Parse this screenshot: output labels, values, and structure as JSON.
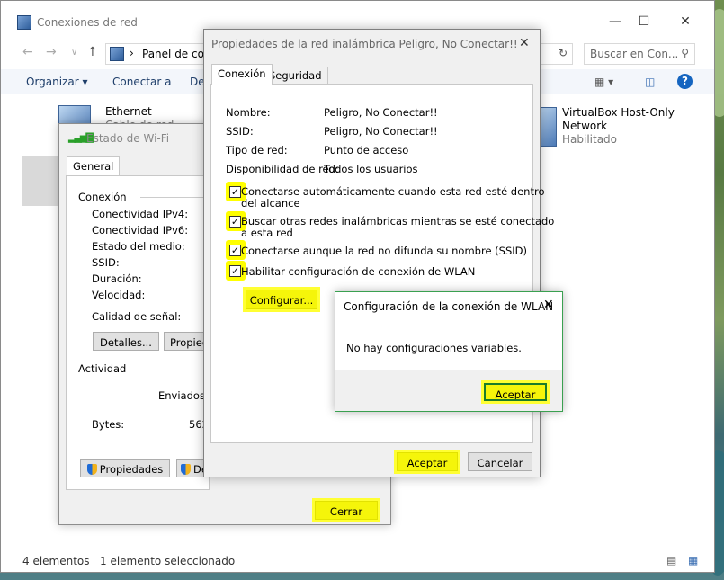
{
  "explorer": {
    "title": "Conexiones de red",
    "address_label": "Panel de cont",
    "search_placeholder": "Buscar en Con...",
    "cmd": {
      "organizar": "Organizar",
      "conectar": "Conectar a",
      "des": "Des"
    },
    "items": [
      {
        "name": "Ethernet",
        "sub": "Cable de red..."
      },
      {
        "name": "VirtualBox Host-Only",
        "name2": "Network",
        "sub": "Habilitado"
      }
    ],
    "status": {
      "count": "4 elementos",
      "selected": "1 elemento seleccionado"
    }
  },
  "wifi_status": {
    "title": "Estado de Wi-Fi",
    "tab": "General",
    "section_connection": "Conexión",
    "fields": [
      "Conectividad IPv4:",
      "Conectividad IPv6:",
      "Estado del medio:",
      "SSID:",
      "Duración:",
      "Velocidad:"
    ],
    "signal_label": "Calidad de señal:",
    "details_button": "Detalles...",
    "props_button_partial": "Propieda",
    "section_activity": "Actividad",
    "sent_label": "Enviados",
    "bytes_label": "Bytes:",
    "bytes_value": "562",
    "properties_button": "Propiedades",
    "disable_button_partial": "De",
    "close_button": "Cerrar"
  },
  "props": {
    "title": "Propiedades de la red inalámbrica Peligro, No Conectar!!",
    "tabs": [
      "Conexión",
      "Seguridad"
    ],
    "rows": [
      {
        "label": "Nombre:",
        "value": "Peligro, No Conectar!!"
      },
      {
        "label": "SSID:",
        "value": "Peligro, No Conectar!!"
      },
      {
        "label": "Tipo de red:",
        "value": "Punto de acceso"
      },
      {
        "label": "Disponibilidad de red:",
        "value": "Todos los usuarios"
      }
    ],
    "checks": [
      {
        "line1": "Conectarse automáticamente cuando esta red esté dentro",
        "line2": "del alcance",
        "checked": true
      },
      {
        "line1": "Buscar otras redes inalámbricas mientras se esté conectado",
        "line2": "a esta red",
        "checked": true
      },
      {
        "line1": "Conectarse aunque la red no difunda su nombre (SSID)",
        "line2": "",
        "checked": true
      },
      {
        "line1": "Habilitar configuración de conexión de WLAN",
        "line2": "",
        "checked": true
      }
    ],
    "configure_button": "Configurar...",
    "ok_button": "Aceptar",
    "cancel_button": "Cancelar"
  },
  "wlan_config": {
    "title": "Configuración de la conexión de WLAN",
    "message": "No hay configuraciones variables.",
    "ok_button": "Aceptar"
  },
  "colors": {
    "highlight": "#ffff00",
    "accent": "#0078d7"
  }
}
